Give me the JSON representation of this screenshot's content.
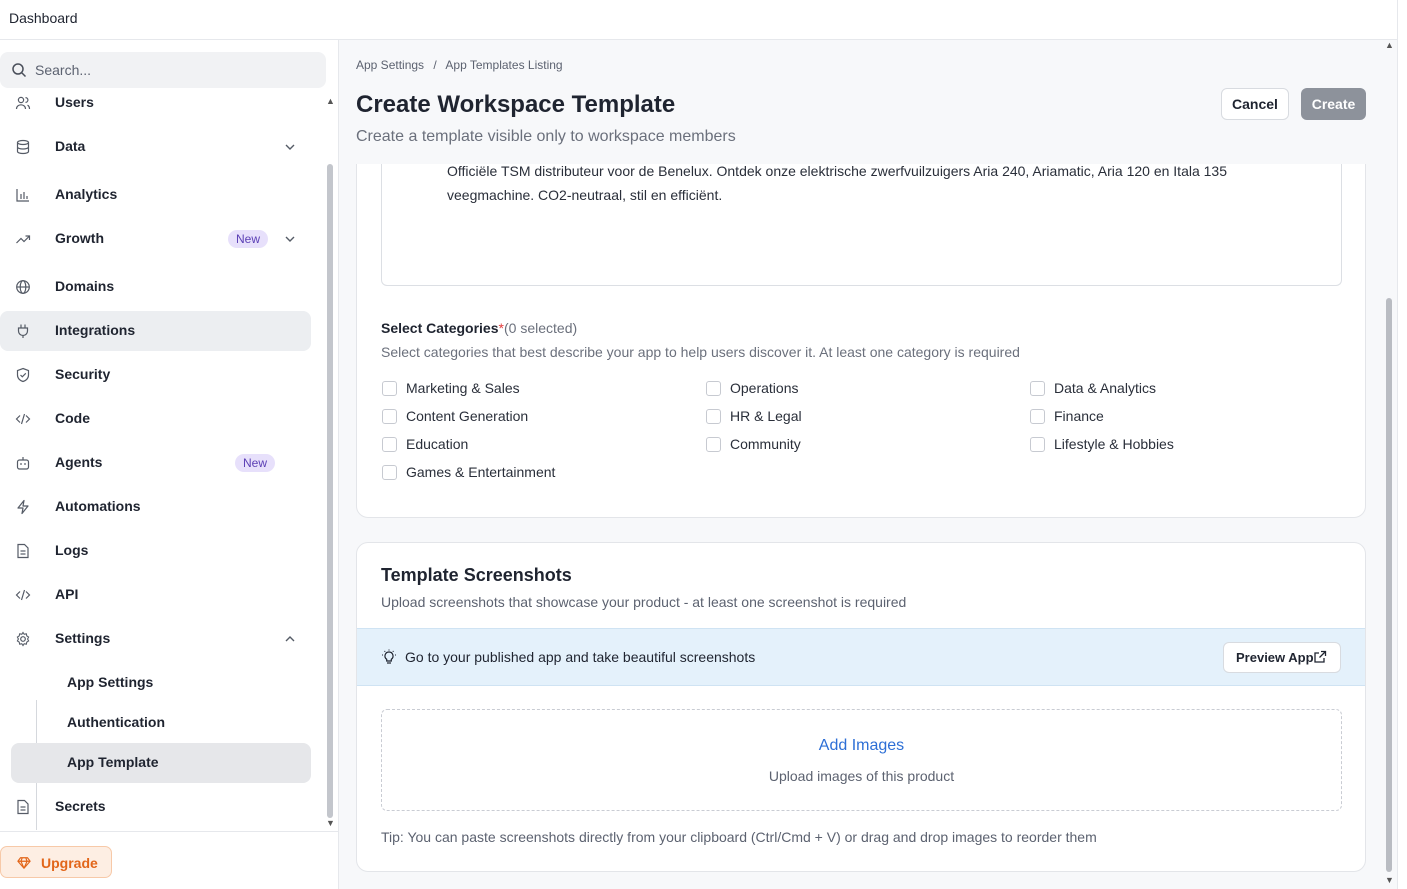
{
  "topbar": {
    "title": "Dashboard"
  },
  "search": {
    "placeholder": "Search..."
  },
  "sidebar": {
    "items": [
      {
        "label": "Users",
        "icon": "users-icon"
      },
      {
        "label": "Data",
        "icon": "database-icon",
        "chevron": "down"
      },
      {
        "label": "Analytics",
        "icon": "bar-chart-icon"
      },
      {
        "label": "Growth",
        "icon": "trending-up-icon",
        "badge": "New",
        "chevron": "down"
      },
      {
        "label": "Domains",
        "icon": "globe-icon"
      },
      {
        "label": "Integrations",
        "icon": "plug-icon",
        "active": true
      },
      {
        "label": "Security",
        "icon": "shield-icon"
      },
      {
        "label": "Code",
        "icon": "code-icon"
      },
      {
        "label": "Agents",
        "icon": "bot-icon",
        "badge": "New"
      },
      {
        "label": "Automations",
        "icon": "zap-icon"
      },
      {
        "label": "Logs",
        "icon": "file-text-icon"
      },
      {
        "label": "API",
        "icon": "code-icon"
      },
      {
        "label": "Settings",
        "icon": "gear-icon",
        "chevron": "up"
      }
    ],
    "settings_children": [
      {
        "label": "App Settings"
      },
      {
        "label": "Authentication"
      },
      {
        "label": "App Template",
        "active": true
      }
    ],
    "secrets": {
      "label": "Secrets",
      "icon": "file-lock-icon"
    },
    "upgrade": {
      "label": "Upgrade",
      "icon": "gem-icon",
      "color": "#e2661a"
    }
  },
  "header": {
    "breadcrumbs": [
      "App Settings",
      "/",
      "App Templates Listing"
    ],
    "title": "Create Workspace Template",
    "subtitle": "Create a template visible only to workspace members",
    "cancel_label": "Cancel",
    "create_label": "Create"
  },
  "description": {
    "value": "Officiële TSM distributeur voor de Benelux. Ontdek onze elektrische zwerfvuilzuigers Aria 240, Ariamatic, Aria 120 en Itala 135 veegmachine. CO2-neutraal, stil en efficiënt."
  },
  "categories": {
    "label": "Select Categories",
    "required_mark": "*",
    "count": "(0 selected)",
    "help": "Select categories that best describe your app to help users discover it. At least one category is required",
    "options": [
      "Marketing & Sales",
      "Operations",
      "Data & Analytics",
      "Content Generation",
      "HR & Legal",
      "Finance",
      "Education",
      "Community",
      "Lifestyle & Hobbies",
      "Games & Entertainment"
    ]
  },
  "screenshots": {
    "title": "Template Screenshots",
    "subtitle": "Upload screenshots that showcase your product - at least one screenshot is required",
    "tip_banner": "Go to your published app and take beautiful screenshots",
    "preview_label": "Preview App",
    "add_label": "Add Images",
    "add_sub": "Upload images of this product",
    "footer_tip": "Tip: You can paste screenshots directly from your clipboard (Ctrl/Cmd + V) or drag and drop images to reorder them"
  },
  "colors": {
    "accent_link": "#2d6fd6",
    "badge_bg": "#e7e0fb",
    "badge_text": "#5b3fb5",
    "create_disabled": "#8d929b",
    "tip_bg": "#e4f1fb"
  }
}
